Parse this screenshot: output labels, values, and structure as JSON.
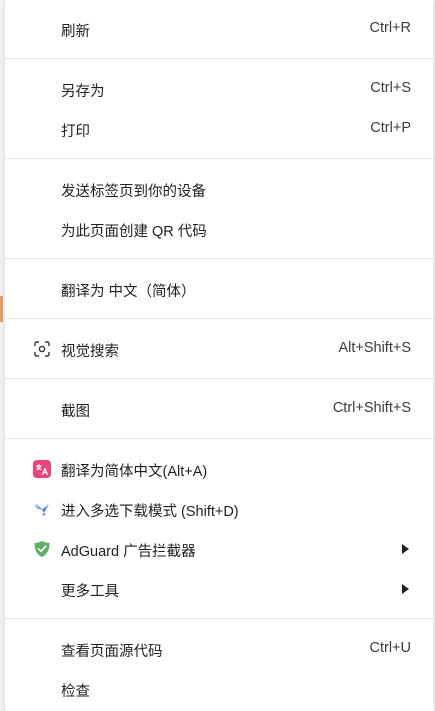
{
  "menu": {
    "items": [
      {
        "label": "刷新",
        "shortcut": "Ctrl+R"
      },
      {
        "label": "另存为",
        "shortcut": "Ctrl+S"
      },
      {
        "label": "打印",
        "shortcut": "Ctrl+P"
      },
      {
        "label": "发送标签页到你的设备",
        "shortcut": ""
      },
      {
        "label": "为此页面创建 QR 代码",
        "shortcut": ""
      },
      {
        "label": "翻译为 中文（简体）",
        "shortcut": ""
      },
      {
        "label": "视觉搜索",
        "shortcut": "Alt+Shift+S",
        "icon": "visual-search-icon"
      },
      {
        "label": "截图",
        "shortcut": "Ctrl+Shift+S"
      },
      {
        "label": "翻译为简体中文(Alt+A)",
        "shortcut": "",
        "icon": "translate-icon",
        "icon_color": "#e8457c"
      },
      {
        "label": "进入多选下载模式 (Shift+D)",
        "shortcut": "",
        "icon": "bird-icon",
        "icon_color": "#4a7cf0"
      },
      {
        "label": "AdGuard 广告拦截器",
        "shortcut": "",
        "icon": "shield-icon",
        "icon_color": "#5fae6a",
        "submenu": true
      },
      {
        "label": "更多工具",
        "shortcut": "",
        "submenu": true
      },
      {
        "label": "查看页面源代码",
        "shortcut": "Ctrl+U"
      },
      {
        "label": "检查",
        "shortcut": ""
      }
    ]
  },
  "colors": {
    "menu_bg": "#ffffff",
    "separator": "#e3e3e3",
    "text": "#1f1f1f"
  }
}
